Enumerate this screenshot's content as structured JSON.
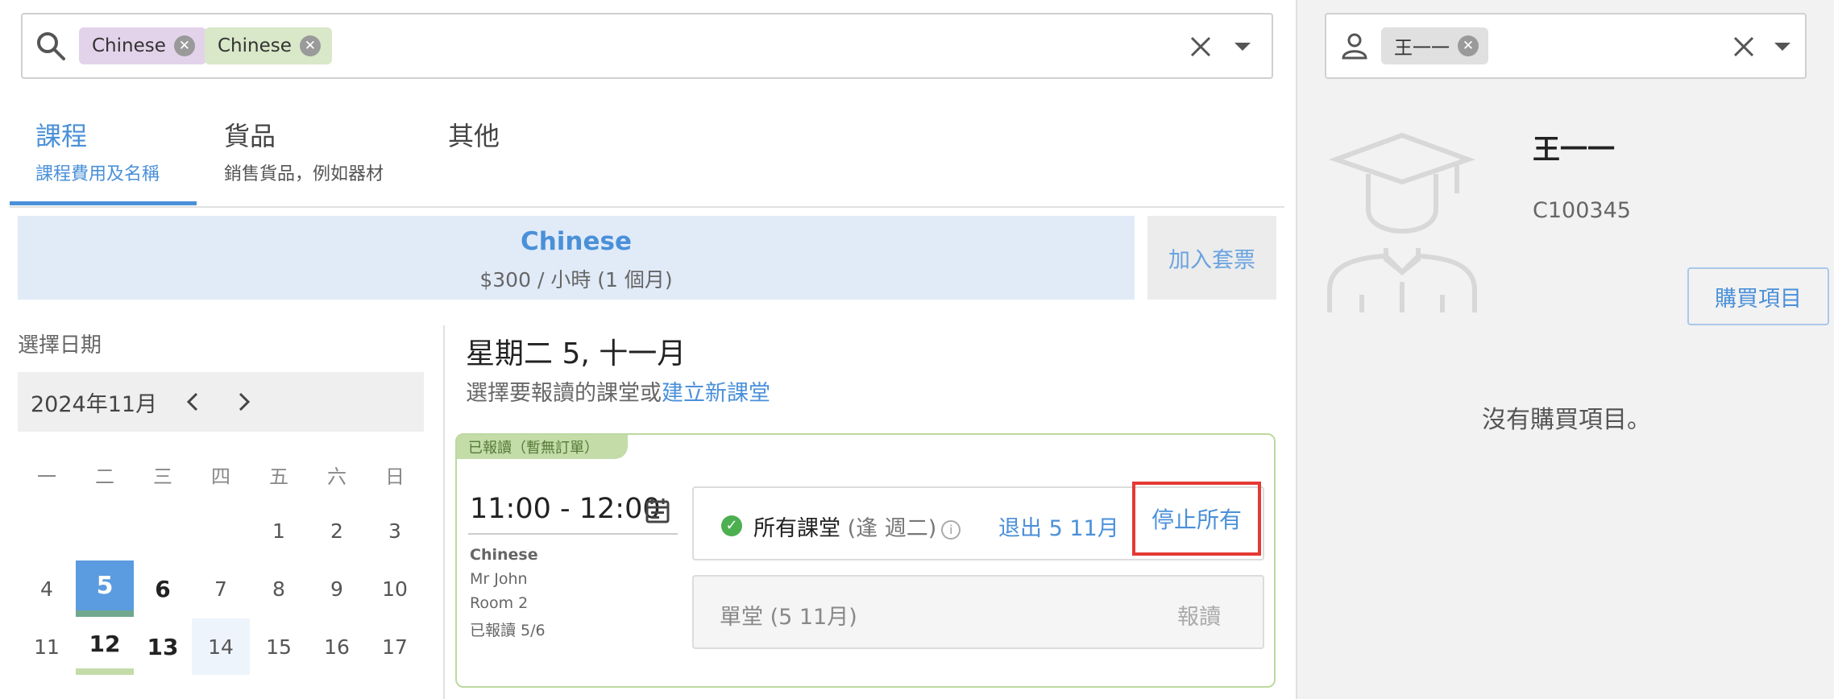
{
  "search": {
    "chips": [
      {
        "label": "Chinese",
        "bg": "#e3d3ea"
      },
      {
        "label": "Chinese",
        "bg": "#d8e8c8"
      }
    ]
  },
  "tabs": [
    {
      "title": "課程",
      "subtitle": "課程費用及名稱",
      "active": true
    },
    {
      "title": "貨品",
      "subtitle": "銷售貨品，例如器材",
      "active": false
    },
    {
      "title": "其他",
      "subtitle": "",
      "active": false
    }
  ],
  "banner": {
    "title": "Chinese",
    "price": "$300 / 小時 (1 個月)",
    "add_package": "加入套票"
  },
  "calendar": {
    "label": "選擇日期",
    "month": "2024年11月",
    "weekdays": [
      "一",
      "二",
      "三",
      "四",
      "五",
      "六",
      "日"
    ],
    "rows": [
      [
        "",
        "",
        "",
        "",
        "1",
        "2",
        "3"
      ],
      [
        "4",
        "5",
        "6",
        "7",
        "8",
        "9",
        "10"
      ],
      [
        "11",
        "12",
        "13",
        "14",
        "15",
        "16",
        "17"
      ]
    ],
    "selected": "5",
    "bold_days": [
      "6",
      "12",
      "13"
    ],
    "today": "14",
    "marked_days": [
      "12"
    ]
  },
  "schedule": {
    "date_title": "星期二 5, 十一月",
    "subtitle_prefix": "選擇要報讀的課堂或",
    "create_link": "建立新課堂",
    "badge": "已報讀（暫無訂單）",
    "time": "11:00 - 12:00",
    "course": "Chinese",
    "teacher": "Mr John",
    "room": "Room 2",
    "enrolled_count": "已報讀 5/6",
    "all_label": "所有課堂",
    "all_label_muted": "(逢 週二)",
    "withdraw": "退出 5 11月",
    "stop_all": "停止所有",
    "single_label": "單堂 (5 11月)",
    "enroll": "報讀"
  },
  "profile": {
    "chip": "王一一",
    "name": "王一一",
    "id": "C100345",
    "buy_button": "購買項目",
    "empty_message": "沒有購買項目。"
  },
  "colors": {
    "accent": "#4a90d9",
    "highlight": "#e53935"
  }
}
